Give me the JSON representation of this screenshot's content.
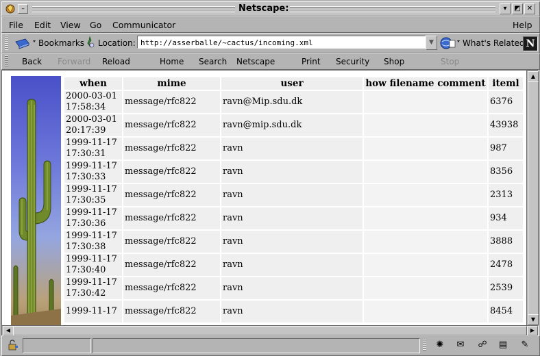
{
  "window": {
    "title": "Netscape:"
  },
  "menubar": {
    "items": [
      "File",
      "Edit",
      "View",
      "Go",
      "Communicator"
    ],
    "help": "Help"
  },
  "location_bar": {
    "bookmarks_label": "Bookmarks",
    "location_label": "Location:",
    "url": "http://asserballe/~cactus/incoming.xml",
    "whats_related": "What's Related",
    "logo_letter": "N"
  },
  "nav_toolbar": {
    "back": "Back",
    "forward": "Forward",
    "reload": "Reload",
    "home": "Home",
    "search": "Search",
    "netscape": "Netscape",
    "print": "Print",
    "security": "Security",
    "shop": "Shop",
    "stop": "Stop"
  },
  "table": {
    "headers": [
      "when",
      "mime",
      "user",
      "how",
      "filename",
      "comment",
      "iteml"
    ],
    "rows": [
      {
        "date": "2000-03-01",
        "time": "17:58:34",
        "mime": "message/rfc822",
        "user": "ravn@Mip.sdu.dk",
        "iteml": "6376"
      },
      {
        "date": "2000-03-01",
        "time": "20:17:39",
        "mime": "message/rfc822",
        "user": "ravn@mip.sdu.dk",
        "iteml": "43938"
      },
      {
        "date": "1999-11-17",
        "time": "17:30:31",
        "mime": "message/rfc822",
        "user": "ravn",
        "iteml": "987"
      },
      {
        "date": "1999-11-17",
        "time": "17:30:33",
        "mime": "message/rfc822",
        "user": "ravn",
        "iteml": "8356"
      },
      {
        "date": "1999-11-17",
        "time": "17:30:35",
        "mime": "message/rfc822",
        "user": "ravn",
        "iteml": "2313"
      },
      {
        "date": "1999-11-17",
        "time": "17:30:36",
        "mime": "message/rfc822",
        "user": "ravn",
        "iteml": "934"
      },
      {
        "date": "1999-11-17",
        "time": "17:30:38",
        "mime": "message/rfc822",
        "user": "ravn",
        "iteml": "3888"
      },
      {
        "date": "1999-11-17",
        "time": "17:30:40",
        "mime": "message/rfc822",
        "user": "ravn",
        "iteml": "2478"
      },
      {
        "date": "1999-11-17",
        "time": "17:30:42",
        "mime": "message/rfc822",
        "user": "ravn",
        "iteml": "2539"
      },
      {
        "date": "1999-11-17",
        "time": "",
        "mime": "message/rfc822",
        "user": "ravn",
        "iteml": "8454"
      }
    ]
  },
  "icons": {
    "window": "netscape-window-icon",
    "bookmarks": "bookmarks-icon",
    "location": "location-icon",
    "whats_related": "whats-related-icon",
    "security_lock": "security-lock-icon",
    "component_bar": [
      "navigator-icon",
      "mail-icon",
      "discussions-icon",
      "composer-icon",
      "address-book-icon"
    ]
  }
}
